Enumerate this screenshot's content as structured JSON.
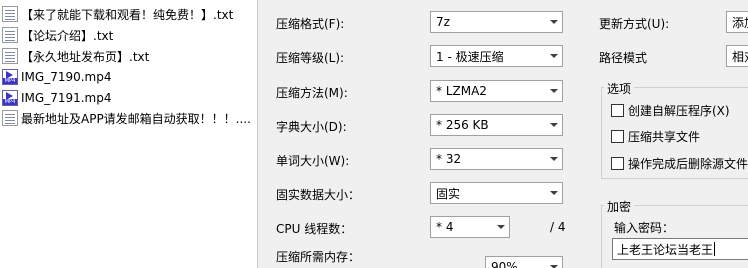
{
  "files": [
    {
      "name": "【来了就能下载和观看！纯免费！】.txt",
      "icon": "txt-file-icon"
    },
    {
      "name": "【论坛介绍】.txt",
      "icon": "txt-file-icon"
    },
    {
      "name": "【永久地址发布页】.txt",
      "icon": "txt-file-icon"
    },
    {
      "name": "IMG_7190.mp4",
      "icon": "mp4-file-icon"
    },
    {
      "name": "IMG_7191.mp4",
      "icon": "mp4-file-icon"
    },
    {
      "name": "最新地址及APP请发邮箱自动获取！！！....",
      "icon": "txt-file-icon"
    }
  ],
  "mp4_badge": "MP4",
  "options": {
    "format": {
      "label": "压缩格式(F):",
      "value": "7z"
    },
    "level": {
      "label": "压缩等级(L):",
      "value": "1 - 极速压缩"
    },
    "method": {
      "label": "压缩方法(M):",
      "value": "* LZMA2"
    },
    "dictionary": {
      "label": "字典大小(D):",
      "value": "* 256 KB"
    },
    "word": {
      "label": "单词大小(W):",
      "value": "* 32"
    },
    "solid": {
      "label": "固实数据大小：",
      "value": "固实"
    },
    "threads": {
      "label": "CPU 线程数：",
      "value": "* 4",
      "suffix": "/ 4"
    },
    "memory": {
      "label": "压缩所需内存：",
      "value": "90%"
    }
  },
  "update": {
    "label": "更新方式(U):",
    "value": "添加"
  },
  "path_mode": {
    "label": "路径模式",
    "value": "相对"
  },
  "options_group": {
    "title": "选项",
    "checkboxes": [
      "创建自解压程序(X)",
      "压缩共享文件",
      "操作完成后删除源文件"
    ]
  },
  "encryption": {
    "title": "加密",
    "password_label": "输入密码：",
    "password_value": "上老王论坛当老王"
  }
}
